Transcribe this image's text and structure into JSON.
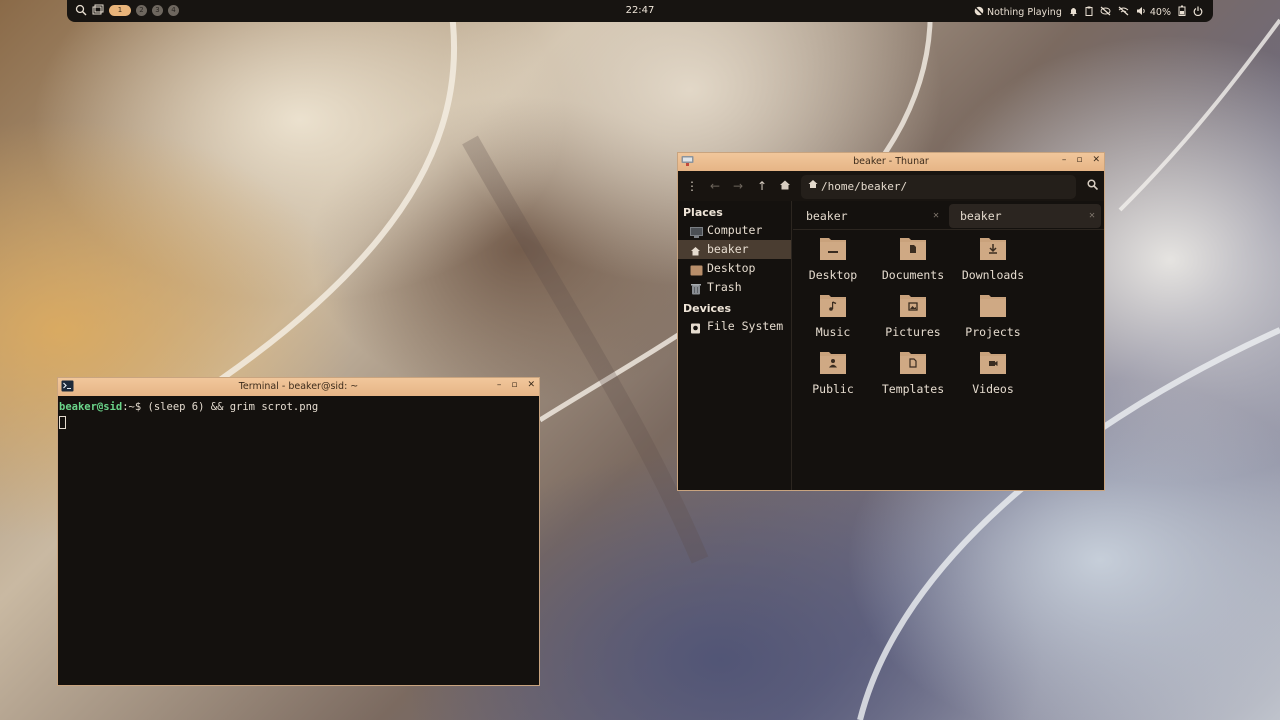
{
  "topbar": {
    "workspaces": [
      "1",
      "2",
      "3",
      "4"
    ],
    "active_workspace": "1",
    "clock": "22:47",
    "media": "Nothing Playing",
    "battery": "40%"
  },
  "terminal": {
    "title": "Terminal - beaker@sid: ~",
    "prompt_user": "beaker@sid",
    "prompt_path": ":~",
    "prompt_symbol": "$ ",
    "command": "(sleep 6) && grim scrot.png"
  },
  "thunar": {
    "title": "beaker - Thunar",
    "path": "/home/beaker/",
    "sidebar": {
      "places_heading": "Places",
      "places": [
        "Computer",
        "beaker",
        "Desktop",
        "Trash"
      ],
      "devices_heading": "Devices",
      "devices": [
        "File System"
      ]
    },
    "tabs": [
      "beaker",
      "beaker"
    ],
    "folders": [
      "Desktop",
      "Documents",
      "Downloads",
      "Music",
      "Pictures",
      "Projects",
      "Public",
      "Templates",
      "Videos"
    ]
  },
  "colors": {
    "titlebar": "#e9b886",
    "window_bg": "#14110e",
    "folder": "#c9a27c",
    "accent_workspace": "#e9b47a"
  }
}
